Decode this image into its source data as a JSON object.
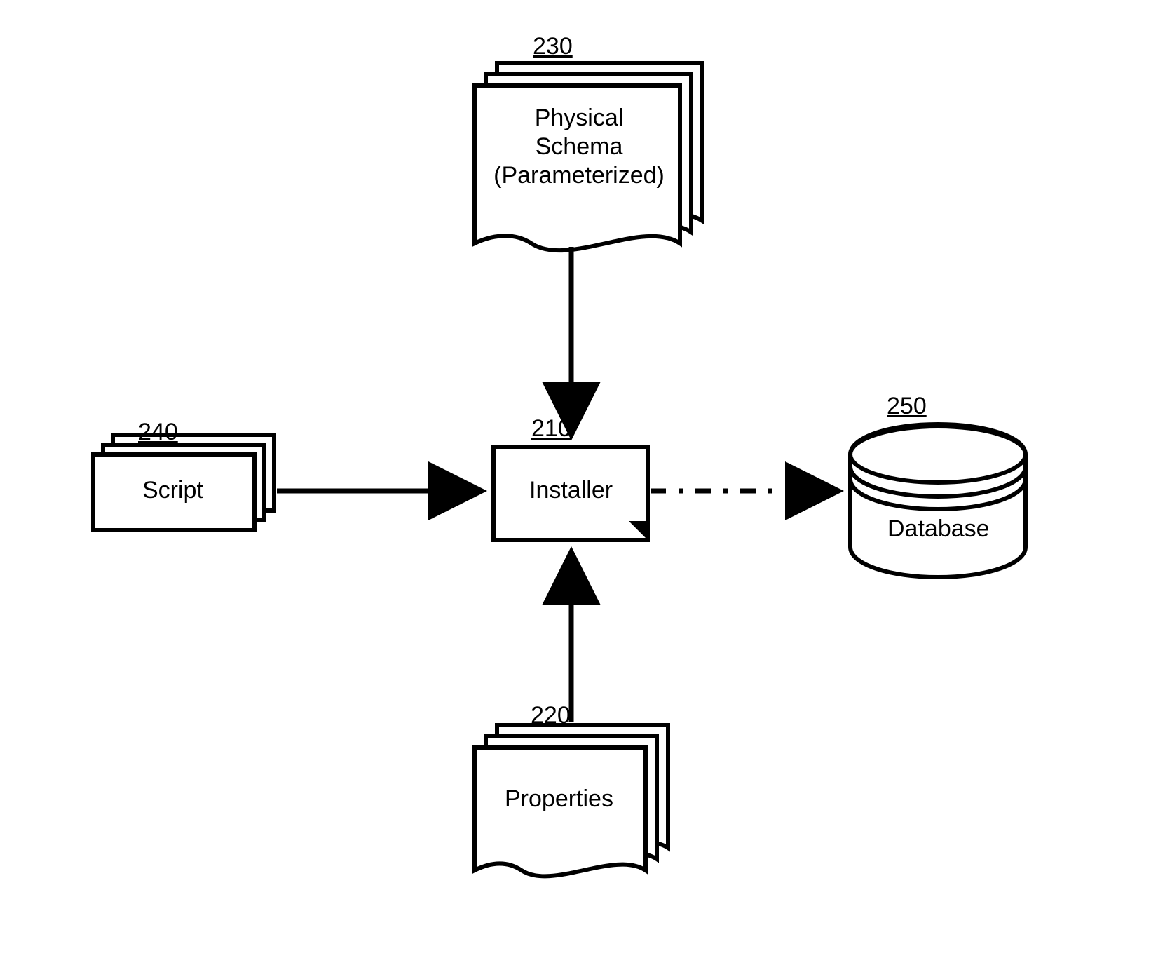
{
  "diagram": {
    "nodes": {
      "script": {
        "ref": "240",
        "label": "Script"
      },
      "installer": {
        "ref": "210",
        "label": "Installer"
      },
      "physical_schema": {
        "ref": "230",
        "label": "Physical\nSchema\n(Parameterized)"
      },
      "properties": {
        "ref": "220",
        "label": "Properties"
      },
      "database": {
        "ref": "250",
        "label": "Database"
      }
    },
    "edges": [
      {
        "from": "script",
        "to": "installer",
        "style": "solid"
      },
      {
        "from": "physical_schema",
        "to": "installer",
        "style": "solid"
      },
      {
        "from": "properties",
        "to": "installer",
        "style": "solid"
      },
      {
        "from": "installer",
        "to": "database",
        "style": "dashed"
      }
    ]
  }
}
